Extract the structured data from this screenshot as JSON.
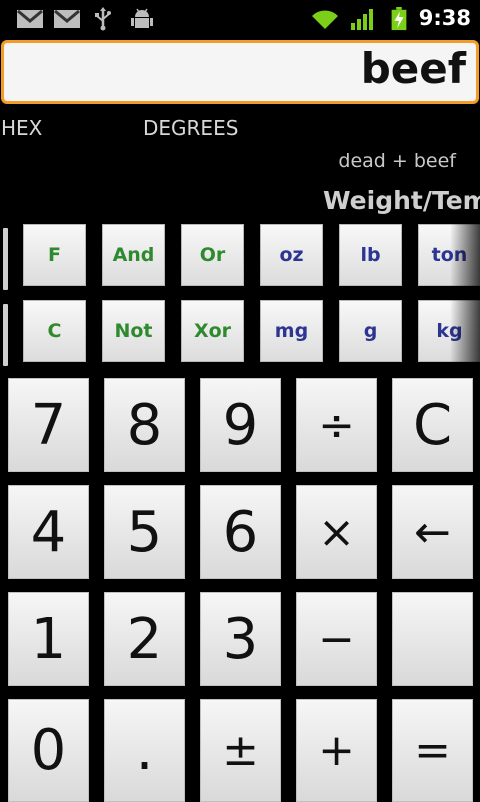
{
  "status_bar": {
    "time": "9:38",
    "icons": [
      "gmail-icon",
      "gmail-icon",
      "usb-icon",
      "android-debug-icon",
      "wifi-icon",
      "signal-icon",
      "battery-charging-icon"
    ]
  },
  "display": {
    "value": "beef"
  },
  "modes": {
    "base": "HEX",
    "angle": "DEGREES"
  },
  "history": "dead + beef",
  "panel_title": "Weight/Tem",
  "function_rows": [
    [
      {
        "label": "F",
        "color": "green"
      },
      {
        "label": "And",
        "color": "green"
      },
      {
        "label": "Or",
        "color": "green"
      },
      {
        "label": "oz",
        "color": "blue"
      },
      {
        "label": "lb",
        "color": "blue"
      },
      {
        "label": "ton",
        "color": "blue"
      }
    ],
    [
      {
        "label": "C",
        "color": "green"
      },
      {
        "label": "Not",
        "color": "green"
      },
      {
        "label": "Xor",
        "color": "green"
      },
      {
        "label": "mg",
        "color": "blue"
      },
      {
        "label": "g",
        "color": "blue"
      },
      {
        "label": "kg",
        "color": "blue"
      }
    ]
  ],
  "keypad": [
    [
      "7",
      "8",
      "9",
      "÷",
      "C"
    ],
    [
      "4",
      "5",
      "6",
      "×",
      "←"
    ],
    [
      "1",
      "2",
      "3",
      "−",
      ""
    ],
    [
      "0",
      ".",
      "±",
      "+",
      "="
    ]
  ],
  "colors": {
    "accent": "#f39b2b",
    "green_text": "#2f8a2f",
    "blue_text": "#2d3592"
  }
}
